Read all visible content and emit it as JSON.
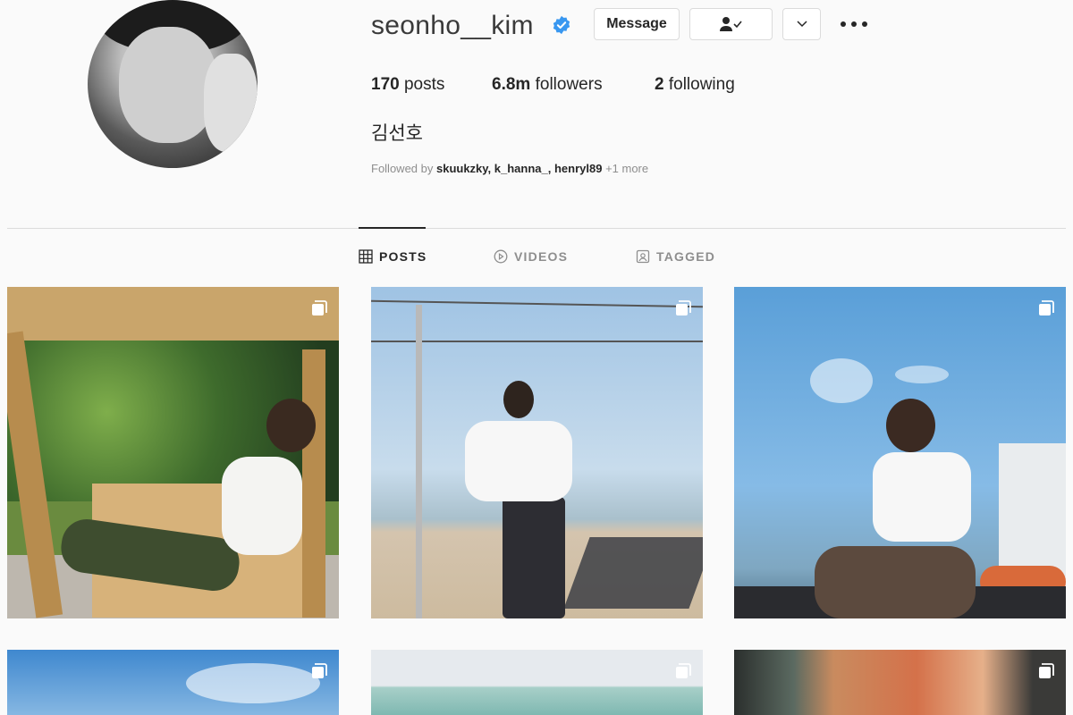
{
  "profile": {
    "username": "seonho__kim",
    "full_name": "김선호",
    "verified": true
  },
  "actions": {
    "message_label": "Message"
  },
  "stats": {
    "posts_count": "170",
    "posts_label": "posts",
    "followers_count": "6.8m",
    "followers_label": "followers",
    "following_count": "2",
    "following_label": "following"
  },
  "followed_by": {
    "prefix": "Followed by ",
    "names": "skuukzky, k_hanna_, henryl89",
    "more": " +1 more"
  },
  "tabs": [
    {
      "label": "POSTS",
      "icon": "grid-icon",
      "active": true
    },
    {
      "label": "VIDEOS",
      "icon": "play-icon",
      "active": false
    },
    {
      "label": "TAGGED",
      "icon": "tag-icon",
      "active": false
    }
  ],
  "posts": [
    {
      "scene": "wooden-swing",
      "multiple": true
    },
    {
      "scene": "beach-string-lights",
      "multiple": true
    },
    {
      "scene": "sky-boat-deck",
      "multiple": true
    },
    {
      "scene": "blue-sky-clouds",
      "multiple": true
    },
    {
      "scene": "rooftop-teal",
      "multiple": true
    },
    {
      "scene": "orange-doorway",
      "multiple": true
    }
  ],
  "colors": {
    "background": "#fafafa",
    "text": "#262626",
    "muted": "#8e8e8e",
    "border": "#dbdbdb",
    "verified_blue": "#3897f0"
  }
}
